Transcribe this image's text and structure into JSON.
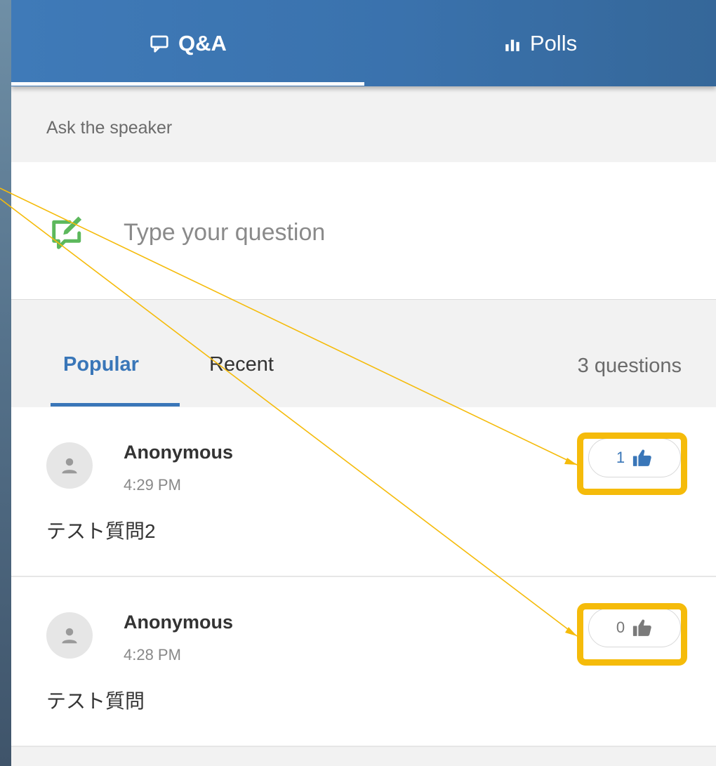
{
  "tabs": {
    "qa_label": "Q&A",
    "polls_label": "Polls",
    "active": "qa"
  },
  "ask": {
    "label": "Ask the speaker",
    "placeholder": "Type your question"
  },
  "sort": {
    "popular_label": "Popular",
    "recent_label": "Recent",
    "active": "popular",
    "count_text": "3 questions"
  },
  "questions": [
    {
      "author": "Anonymous",
      "time": "4:29 PM",
      "text": "テスト質問2",
      "likes": "1",
      "liked": true
    },
    {
      "author": "Anonymous",
      "time": "4:28 PM",
      "text": "テスト質問",
      "likes": "0",
      "liked": false
    }
  ],
  "icons": {
    "qa_tab": "chat-bubble-icon",
    "polls_tab": "bar-chart-icon",
    "compose": "edit-note-icon",
    "avatar": "person-icon",
    "like": "thumbs-up-icon"
  },
  "colors": {
    "header": "#3a72ad",
    "accent": "#3976b8",
    "compose_icon": "#5cb85c",
    "highlight": "#f5bb0a"
  }
}
